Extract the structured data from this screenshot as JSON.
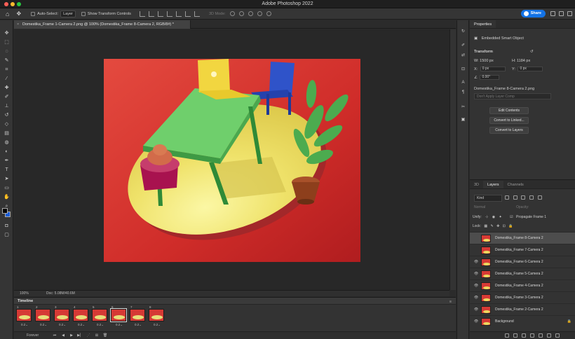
{
  "app": {
    "title": "Adobe Photoshop 2022"
  },
  "options": {
    "auto_select_label": "Auto-Select:",
    "auto_select_value": "Layer",
    "show_transform_label": "Show Transform Controls",
    "mode3d_label": "3D Mode:",
    "share_label": "Share"
  },
  "document": {
    "tab_title": "Domestika_Frame 1-Camera 2.png @ 100% (Domestika_Frame 8-Camera 2, RGB/8#) *",
    "zoom": "100%",
    "doc_info": "Doc: 5.08M/40.6M"
  },
  "timeline": {
    "title": "Timeline",
    "loop": "Forever",
    "frames": [
      {
        "num": "1",
        "delay": "0.2"
      },
      {
        "num": "2",
        "delay": "0.2"
      },
      {
        "num": "3",
        "delay": "0.2"
      },
      {
        "num": "4",
        "delay": "0.2"
      },
      {
        "num": "5",
        "delay": "0.2"
      },
      {
        "num": "6",
        "delay": "0.2"
      },
      {
        "num": "7",
        "delay": "0.2"
      },
      {
        "num": "8",
        "delay": "0.2"
      }
    ],
    "selected_frame": 5
  },
  "properties": {
    "tab": "Properties",
    "object_type": "Embedded Smart Object",
    "transform_label": "Transform",
    "w_label": "W:",
    "w_value": "1500 px",
    "h_label": "H:",
    "h_value": "1184 px",
    "x_label": "X:",
    "x_value": "0 px",
    "y_label": "Y:",
    "y_value": "0 px",
    "angle": "0.00°",
    "file_name": "Domestika_Frame 8-Camera 2.png",
    "comp_placeholder": "Don't Apply Layer Comp",
    "edit_contents": "Edit Contents",
    "convert_linked": "Convert to Linked...",
    "convert_layers": "Convert to Layers"
  },
  "layers": {
    "tabs": [
      "3D",
      "Layers",
      "Channels"
    ],
    "kind_label": "Kind",
    "blend_mode": "Normal",
    "opacity_label": "Opacity:",
    "fill_label": "Fill:",
    "unify_label": "Unify:",
    "propagate_label": "Propagate Frame 1",
    "lock_label": "Lock:",
    "items": [
      {
        "name": "Domestika_Frame 8-Camera 2",
        "visible": false,
        "selected": true
      },
      {
        "name": "Domestika_Frame 7-Camera 2",
        "visible": false,
        "selected": false
      },
      {
        "name": "Domestika_Frame 6-Camera 2",
        "visible": true,
        "selected": false
      },
      {
        "name": "Domestika_Frame 5-Camera 2",
        "visible": true,
        "selected": false
      },
      {
        "name": "Domestika_Frame 4-Camera 2",
        "visible": true,
        "selected": false
      },
      {
        "name": "Domestika_Frame 3-Camera 2",
        "visible": true,
        "selected": false
      },
      {
        "name": "Domestika_Frame 2-Camera 2",
        "visible": true,
        "selected": false
      },
      {
        "name": "Background",
        "visible": true,
        "selected": false
      }
    ]
  },
  "colors": {
    "accent": "#1473e6",
    "foreground": "#000000",
    "background": "#1a5cd6",
    "canvas_bg": "#d63a35"
  }
}
